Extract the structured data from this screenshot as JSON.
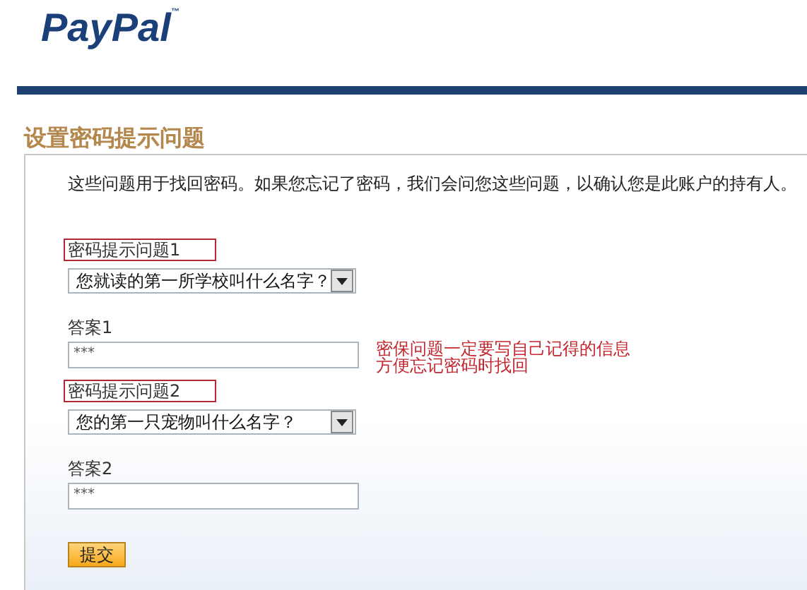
{
  "logo": {
    "text": "PayPal",
    "trademark": "™"
  },
  "title": "设置密码提示问题",
  "intro": "这些问题用于找回密码。如果您忘记了密码，我们会问您这些问题，以确认您是此账户的持有人。",
  "questions": [
    {
      "label": "密码提示问题1",
      "highlighted": true,
      "question": "您就读的第一所学校叫什么名字？",
      "answer_label": "答案1",
      "answer": "***"
    },
    {
      "label": "密码提示问题2",
      "highlighted": true,
      "question": "您的第一只宠物叫什么名字？",
      "answer_label": "答案2",
      "answer": "***"
    }
  ],
  "note": [
    "密保问题一定要写自己记得的信息",
    "方便忘记密码时找回"
  ],
  "submit": "提交"
}
